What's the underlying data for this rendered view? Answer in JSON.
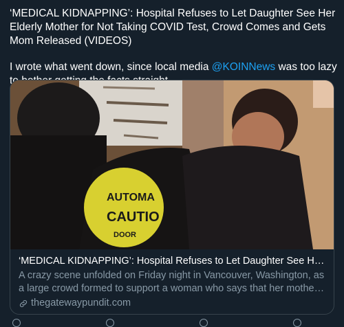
{
  "tweet": {
    "headline": "‘MEDICAL KIDNAPPING’: Hospital Refuses to Let Daughter See Her Elderly Mother for Not Taking COVID Test, Crowd Comes and Gets Mom Released (VIDEOS)",
    "body_before_mention": "I wrote what went down, since local media ",
    "mention": "@KOINNews",
    "body_after_mention": " was too lazy to bother getting the facts straight."
  },
  "card": {
    "title": "‘MEDICAL KIDNAPPING’: Hospital Refuses to Let Daughter See Her El...",
    "description": "A crazy scene unfolded on Friday night in Vancouver, Washington, as a large crowd formed to support a woman who says that her mother wa...",
    "domain": "thegatewaypundit.com",
    "image": {
      "sticker_text": [
        "AUTOMA",
        "CAUTIO",
        "DOOR"
      ],
      "sign_text": "out and available for the Sanderson"
    }
  },
  "colors": {
    "background": "#15202b",
    "text": "#ffffff",
    "secondary": "#8899a6",
    "accent": "#1da1f2",
    "border": "#38444d"
  }
}
